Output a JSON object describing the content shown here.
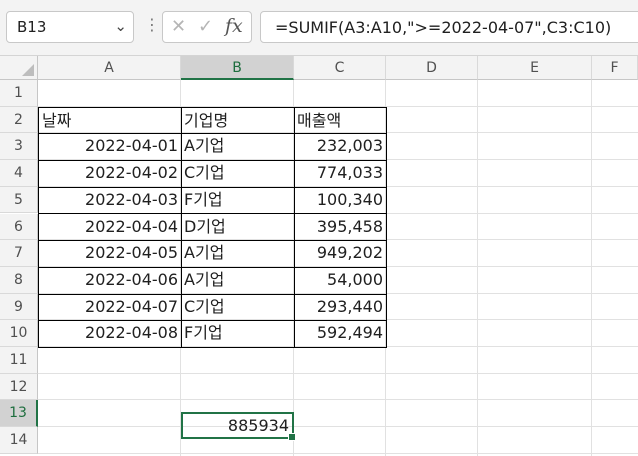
{
  "formula_bar": {
    "name_box": "B13",
    "formula": "=SUMIF(A3:A10,\">=2022-04-07\",C3:C10)",
    "fx_label": "fx"
  },
  "columns": [
    "A",
    "B",
    "C",
    "D",
    "E",
    "F"
  ],
  "rows": [
    "1",
    "2",
    "3",
    "4",
    "5",
    "6",
    "7",
    "8",
    "9",
    "10",
    "11",
    "12",
    "13",
    "14"
  ],
  "table": {
    "headers": [
      "날짜",
      "기업명",
      "매출액"
    ],
    "rows": [
      [
        "2022-04-01",
        "A기업",
        "232,003"
      ],
      [
        "2022-04-02",
        "C기업",
        "774,033"
      ],
      [
        "2022-04-03",
        "F기업",
        "100,340"
      ],
      [
        "2022-04-04",
        "D기업",
        "395,458"
      ],
      [
        "2022-04-05",
        "A기업",
        "949,202"
      ],
      [
        "2022-04-06",
        "A기업",
        "54,000"
      ],
      [
        "2022-04-07",
        "C기업",
        "293,440"
      ],
      [
        "2022-04-08",
        "F기업",
        "592,494"
      ]
    ]
  },
  "selected_cell": {
    "ref": "B13",
    "value": "885934"
  },
  "icons": {
    "cancel": "cancel-x-icon",
    "enter": "enter-check-icon",
    "dropdown": "chevron-down-icon"
  },
  "colors": {
    "accent": "#217346"
  }
}
